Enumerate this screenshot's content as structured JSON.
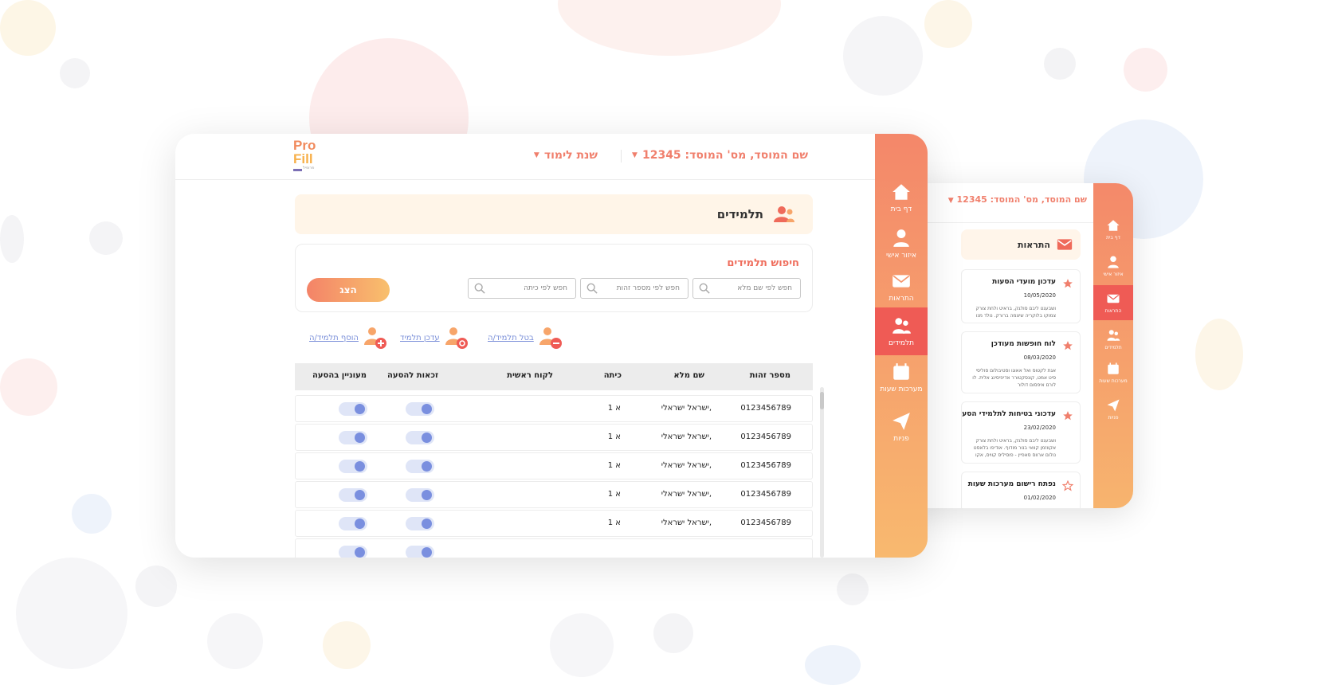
{
  "main": {
    "institution_label": "שם המוסד, מס' המוסד: 12345",
    "year_label": "שנת לימוד",
    "caret": "▼",
    "logo": {
      "line1": "Pro",
      "line2": "Fill",
      "line3": "פרופיל"
    },
    "sidebar": [
      {
        "label": "דף בית",
        "icon": "home-icon"
      },
      {
        "label": "איזור אישי",
        "icon": "user-icon"
      },
      {
        "label": "התראות",
        "icon": "mail-icon"
      },
      {
        "label": "תלמידים",
        "icon": "students-icon",
        "active": true
      },
      {
        "label": "מערכות שעות",
        "icon": "calendar-icon"
      },
      {
        "label": "פניות",
        "icon": "send-icon"
      }
    ],
    "page_title": "תלמידים",
    "search": {
      "title": "חיפוש תלמידים",
      "name_placeholder": "חפש לפי שם מלא",
      "id_placeholder": "חפש לפי מספר זהות",
      "class_placeholder": "חפש לפי כיתה",
      "show_button": "הצג"
    },
    "actions": {
      "add": "הוסף תלמיד/ה",
      "update": "עדכן תלמיד",
      "cancel": "בטל תלמיד/ה"
    },
    "table": {
      "headers": {
        "id": "מספר זהות",
        "name": "שם מלא",
        "class": "כיתה",
        "main_customer": "לקוח ראשית",
        "eligible": "זכאות להסעה",
        "interested": "מעוניין בהסעה"
      },
      "rows": [
        {
          "id": "0123456789",
          "name": "ישראל ישראלי,",
          "class": "א 1",
          "main_customer": "",
          "eligible": true,
          "interested": true
        },
        {
          "id": "0123456789",
          "name": "ישראל ישראלי,",
          "class": "א 1",
          "main_customer": "",
          "eligible": true,
          "interested": true
        },
        {
          "id": "0123456789",
          "name": "ישראל ישראלי,",
          "class": "א 1",
          "main_customer": "",
          "eligible": true,
          "interested": true
        },
        {
          "id": "0123456789",
          "name": "ישראל ישראלי,",
          "class": "א 1",
          "main_customer": "",
          "eligible": true,
          "interested": true
        },
        {
          "id": "0123456789",
          "name": "ישראל ישראלי,",
          "class": "א 1",
          "main_customer": "",
          "eligible": true,
          "interested": true
        }
      ]
    }
  },
  "secondary": {
    "institution_label": "שם המוסד, מס' המוסד: 12345",
    "caret": "▼",
    "sidebar": [
      {
        "label": "דף בית",
        "icon": "home-icon"
      },
      {
        "label": "איזור אישי",
        "icon": "user-icon"
      },
      {
        "label": "התראות",
        "icon": "mail-icon",
        "active": true
      },
      {
        "label": "תלמידים",
        "icon": "students-icon"
      },
      {
        "label": "מערכות שעות",
        "icon": "calendar-icon"
      },
      {
        "label": "פניות",
        "icon": "send-icon"
      }
    ],
    "page_title": "התראות",
    "alerts": [
      {
        "title": "עדכון מועדי הסעות",
        "date": "10/05/2020",
        "line1": "ושבעגט ליבם סולגק, בראיט ולחת צורק",
        "line2": "צמוקו בלוקריה שיצמה ברורק. נולד מנו",
        "starred": true
      },
      {
        "title": "לוח חופשות מעודכן",
        "date": "08/03/2020",
        "line1": "אגת לקטוס ואל אאוגו וסטיבולום סוליסי",
        "line2": "סיט אמט, קונסקטורר אדיפיסינג אלית. לו",
        "line3": "לורם איפסום דולור",
        "starred": true
      },
      {
        "title": "עדכוני בטיחות לתלמידי הסעות",
        "date": "23/02/2020",
        "line1": "ושבעגט ליבם סולגק, בראיט ולחת צורק",
        "line2": "אקווזמן קוואי בנור מודוף. אודיפו בלאסט",
        "line3": "נולום ארווס סאפיין - פוסיליס קוויס, אקו",
        "starred": true
      },
      {
        "title": "נפתח רישום מערכות שעות",
        "date": "01/02/2020",
        "starred": false
      }
    ]
  },
  "colors": {
    "accent": "#f07f6c",
    "sidebar_top": "#f4876a",
    "sidebar_bottom": "#f8b96f",
    "active_item": "#ef5b55",
    "toggle_knob": "#7a8fdf",
    "link": "#7a8fd9"
  }
}
